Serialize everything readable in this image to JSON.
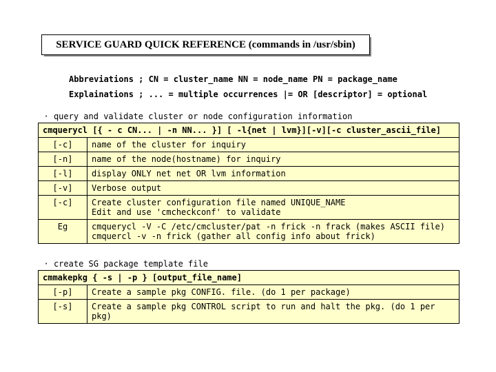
{
  "title": "SERVICE GUARD QUICK REFERENCE (commands in /usr/sbin)",
  "defs": {
    "abbr": "Abbreviations ; CN = cluster_name NN = node_name PN = package_name",
    "expl": "Explainations ; ... = multiple occurrences   |= OR [descriptor] = optional"
  },
  "table1": {
    "caption": "· query and validate cluster or node  configuration information",
    "cmd": "cmquerycl [{ - c CN... | -n NN... }] [ -l{net | lvm}][-v][-c cluster_ascii_file]",
    "rows": [
      {
        "flag": "[-c]",
        "desc": "name of the cluster for inquiry"
      },
      {
        "flag": "[-n]",
        "desc": "name of the node(hostname) for inquiry"
      },
      {
        "flag": "[-l]",
        "desc": "display ONLY net net OR lvm information"
      },
      {
        "flag": "[-v]",
        "desc": "Verbose output"
      },
      {
        "flag": "[-c]",
        "desc": "Create cluster configuration file named UNIQUE_NAME\n  Edit and use 'cmcheckconf' to validate"
      },
      {
        "flag": "Eg",
        "desc": "cmquerycl -V -C /etc/cmcluster/pat -n frick -n frack (makes ASCII file)\ncmquercl -v -n frick (gather all config info about frick)"
      }
    ]
  },
  "table2": {
    "caption": "· create SG package template file",
    "cmd": "cmmakepkg { -s | -p } [output_file_name]",
    "rows": [
      {
        "flag": "[-p]",
        "desc": "Create a sample pkg CONFIG. file. (do 1 per package)"
      },
      {
        "flag": "[-s]",
        "desc": "Create a sample pkg CONTROL script to run and halt the pkg. (do 1 per pkg)"
      }
    ]
  }
}
